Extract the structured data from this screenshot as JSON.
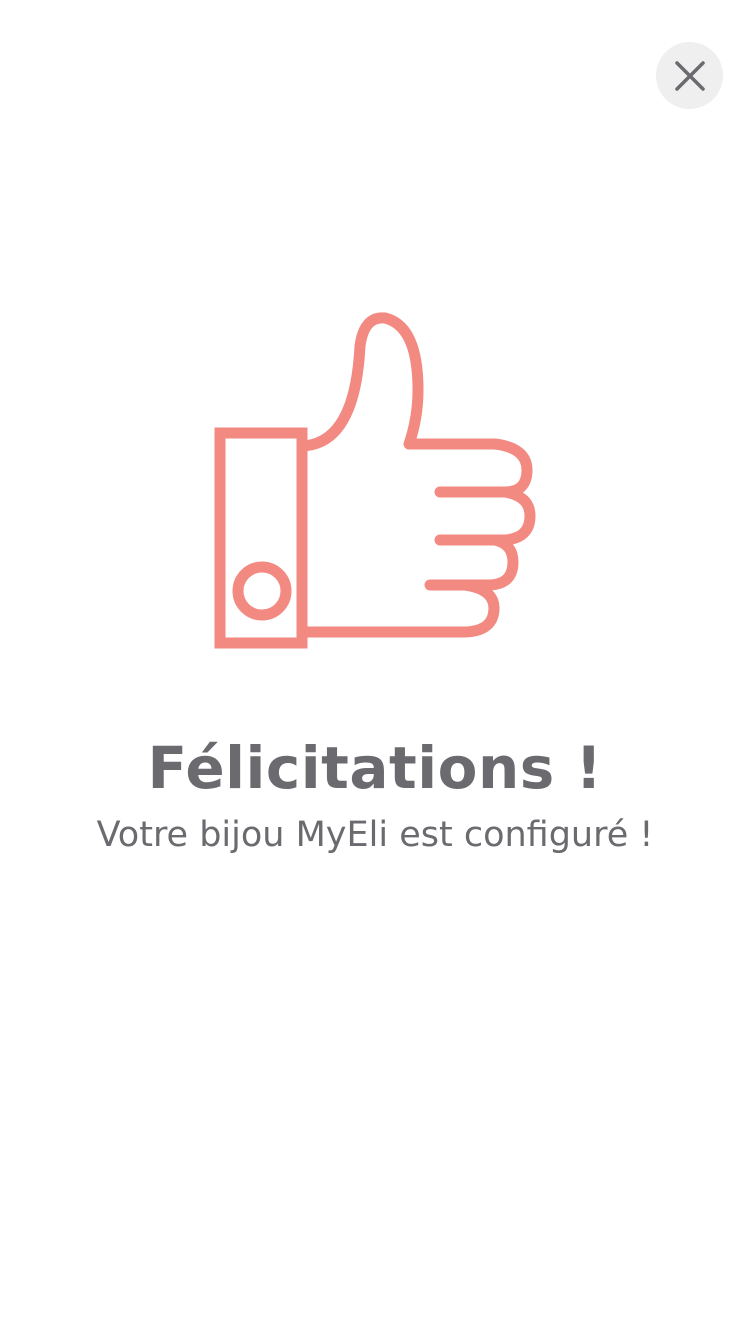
{
  "header": {
    "close_icon": "close-icon"
  },
  "illustration": {
    "icon": "thumbs-up-icon",
    "color": "#f28a82"
  },
  "message": {
    "title": "Félicitations !",
    "subtitle": "Votre bijou MyEli est configuré !"
  },
  "colors": {
    "background": "#ffffff",
    "text": "#6b6b6f",
    "close_bg": "#efefef",
    "close_icon": "#6b6b6f"
  }
}
